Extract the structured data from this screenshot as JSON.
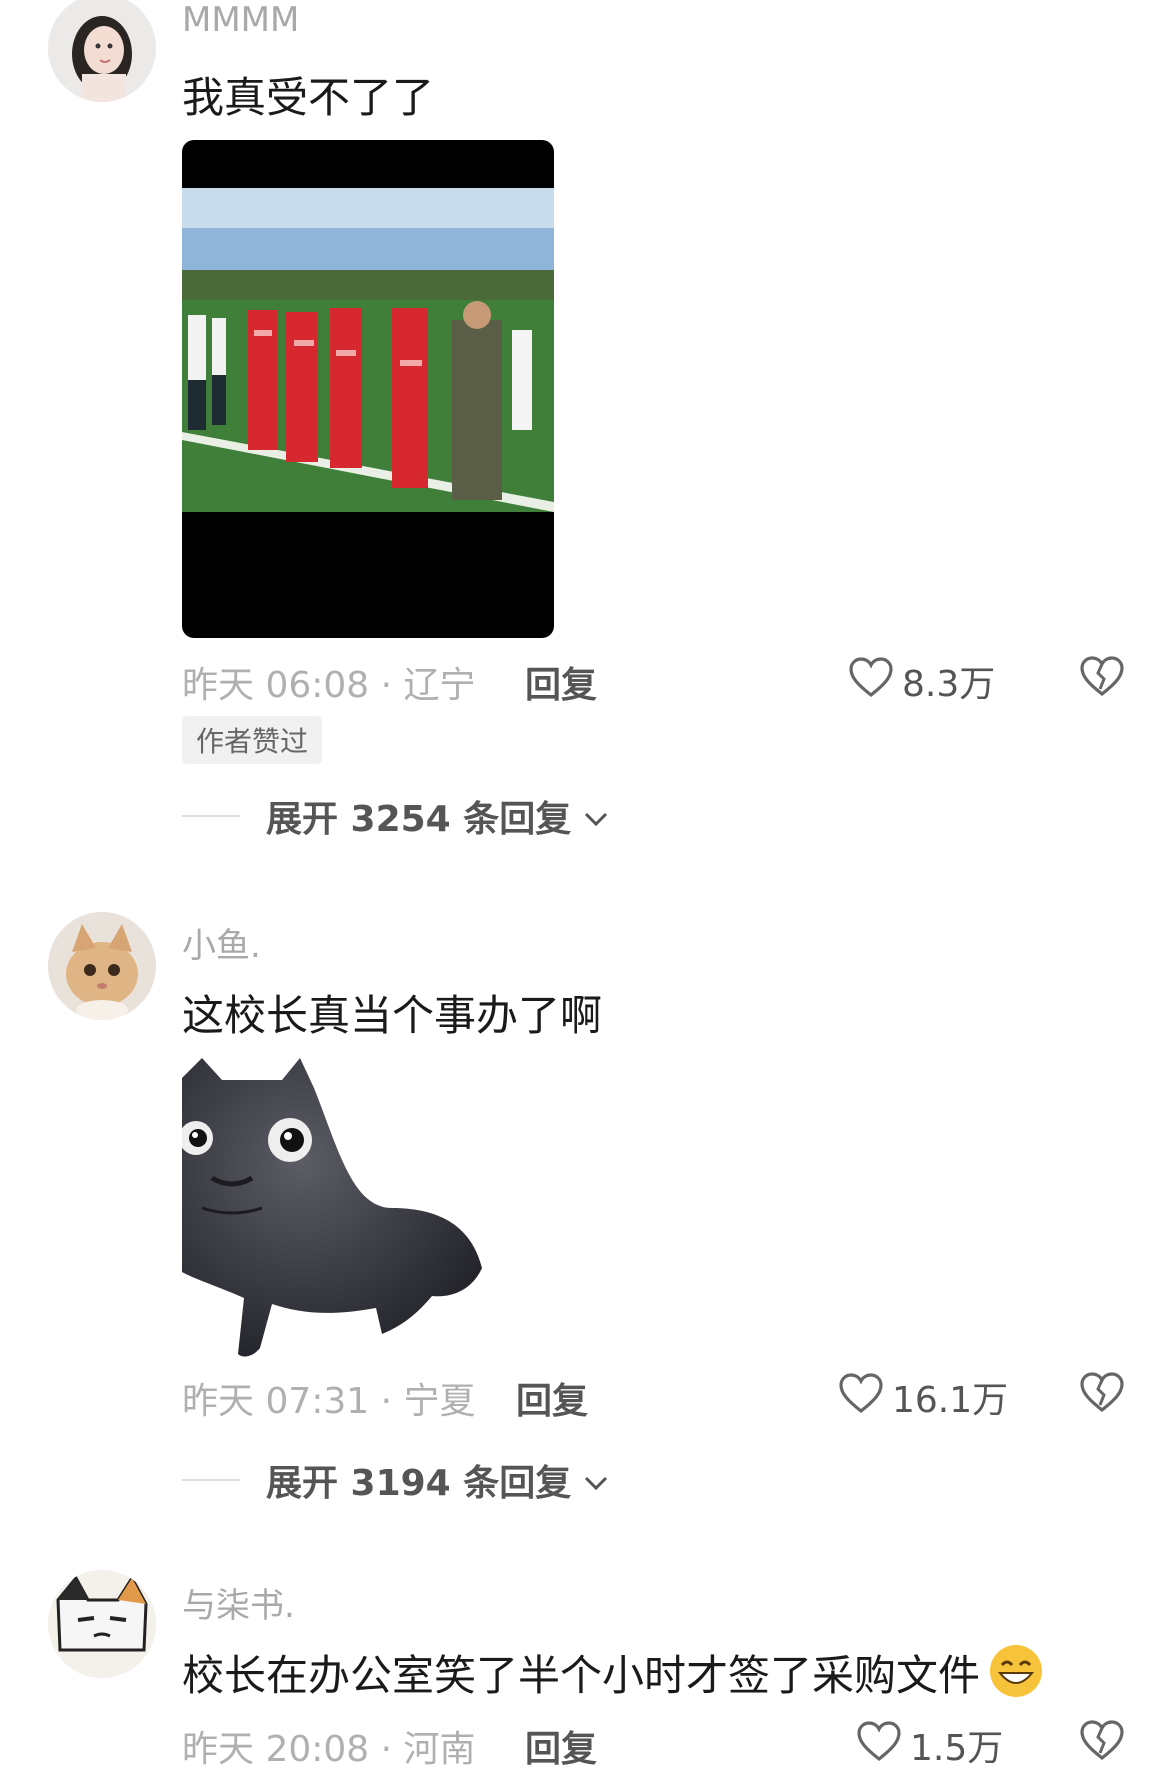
{
  "comments": [
    {
      "username": "MMMM",
      "text": "我真受不了了",
      "time": "昨天 06:08 · 辽宁",
      "reply_label": "回复",
      "likes": "8.3万",
      "author_badge": "作者赞过",
      "expand_label": "展开 3254 条回复"
    },
    {
      "username": "小鱼.",
      "text": "这校长真当个事办了啊",
      "time": "昨天 07:31 · 宁夏",
      "reply_label": "回复",
      "likes": "16.1万",
      "expand_label": "展开 3194 条回复"
    },
    {
      "username": "与柒书.",
      "text": "校长在办公室笑了半个小时才签了采购文件",
      "time": "昨天 20:08 · 河南",
      "reply_label": "回复",
      "likes": "1.5万"
    }
  ]
}
